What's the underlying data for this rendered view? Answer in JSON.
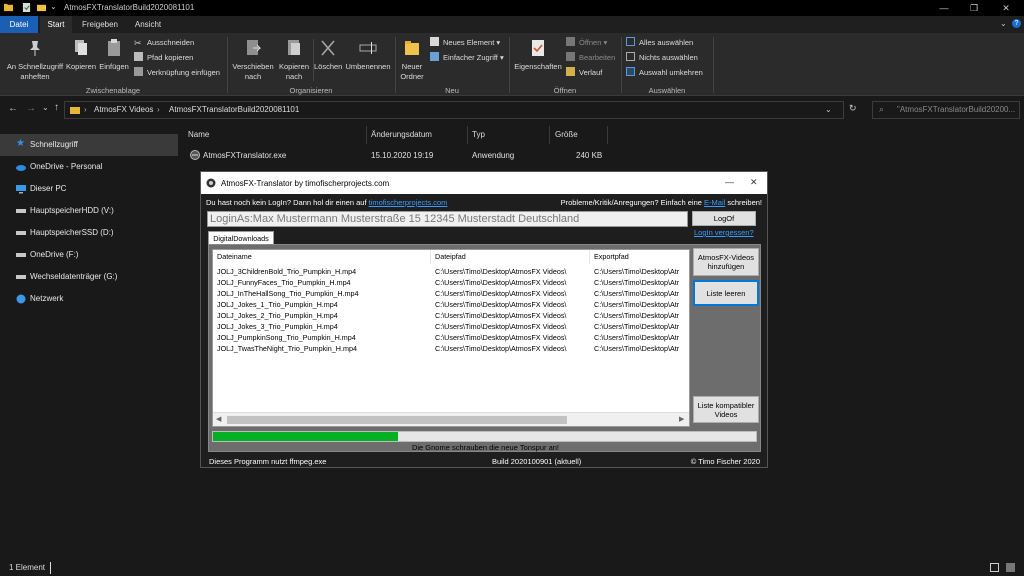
{
  "window": {
    "title": "AtmosFXTranslatorBuild2020081101",
    "controls": [
      "minimize-icon",
      "maximize-icon",
      "close-icon"
    ]
  },
  "ribbon_tabs": [
    "Datei",
    "Start",
    "Freigeben",
    "Ansicht"
  ],
  "ribbon": {
    "clipboard": {
      "pin_label_1": "An Schnellzugriff",
      "pin_label_2": "anheften",
      "copy_label": "Kopieren",
      "paste_label": "Einfügen",
      "cut_label": "Ausschneiden",
      "copy_path_label": "Pfad kopieren",
      "paste_shortcut_label": "Verknüpfung einfügen",
      "group_label": "Zwischenablage"
    },
    "organize": {
      "move_label_1": "Verschieben",
      "move_label_2": "nach",
      "copyto_label_1": "Kopieren",
      "copyto_label_2": "nach",
      "delete_label": "Löschen",
      "rename_label": "Umbenennen",
      "group_label": "Organisieren"
    },
    "new": {
      "newfolder_label_1": "Neuer",
      "newfolder_label_2": "Ordner",
      "newitem_label": "Neues Element",
      "easyaccess_label": "Einfacher Zugriff",
      "group_label": "Neu"
    },
    "open": {
      "properties_label": "Eigenschaften",
      "open_label": "Öffnen",
      "edit_label": "Bearbeiten",
      "history_label": "Verlauf",
      "group_label": "Öffnen"
    },
    "select": {
      "select_all_label": "Alles auswählen",
      "select_none_label": "Nichts auswählen",
      "invert_label": "Auswahl umkehren",
      "group_label": "Auswählen"
    }
  },
  "address": {
    "breadcrumb": [
      "AtmosFX Videos",
      "AtmosFXTranslatorBuild2020081101"
    ],
    "search_placeholder": "\"AtmosFXTranslatorBuild20200..."
  },
  "sidebar": {
    "items": [
      {
        "label": "Schnellzugriff",
        "icon": "star-icon"
      },
      {
        "label": "OneDrive - Personal",
        "icon": "cloud-icon"
      },
      {
        "label": "Dieser PC",
        "icon": "computer-icon"
      },
      {
        "label": "HauptspeicherHDD (V:)",
        "icon": "drive-icon"
      },
      {
        "label": "HauptspeicherSSD (D:)",
        "icon": "drive-icon"
      },
      {
        "label": "OneDrive (F:)",
        "icon": "drive-icon"
      },
      {
        "label": "Wechseldatenträger (G:)",
        "icon": "drive-icon"
      },
      {
        "label": "Netzwerk",
        "icon": "network-icon"
      }
    ]
  },
  "files": {
    "headers": {
      "name": "Name",
      "date": "Änderungsdatum",
      "type": "Typ",
      "size": "Größe"
    },
    "rows": [
      {
        "name": "AtmosFXTranslator.exe",
        "date": "15.10.2020 19:19",
        "type": "Anwendung",
        "size": "240 KB"
      }
    ]
  },
  "status": {
    "count": "1 Element"
  },
  "dialog": {
    "title": "AtmosFX-Translator by timofischerprojects.com",
    "no_login_text": "Du hast noch kein LogIn? Dann hol dir einen auf",
    "no_login_link": "timofischerprojects.com",
    "problems_text": "Probleme/Kritik/Anregungen? Einfach eine",
    "email_link": "E-Mail",
    "problems_suffix": "schreiben!",
    "login_value": "LoginAs:Max Mustermann Musterstraße 15 12345 Musterstadt Deutschland",
    "logoff_label": "LogOf",
    "forgot_link": "LogIn vergessen?",
    "tab_label": "DigitalDownloads",
    "columns": [
      "Dateiname",
      "Dateipfad",
      "Exportpfad"
    ],
    "rows": [
      {
        "name": "JOLJ_3ChildrenBold_Trio_Pumpkin_H.mp4",
        "path": "C:\\Users\\Timo\\Desktop\\AtmosFX Videos\\",
        "export": "C:\\Users\\Timo\\Desktop\\Atr"
      },
      {
        "name": "JOLJ_FunnyFaces_Trio_Pumpkin_H.mp4",
        "path": "C:\\Users\\Timo\\Desktop\\AtmosFX Videos\\",
        "export": "C:\\Users\\Timo\\Desktop\\Atr"
      },
      {
        "name": "JOLJ_InTheHallSong_Trio_Pumpkin_H.mp4",
        "path": "C:\\Users\\Timo\\Desktop\\AtmosFX Videos\\",
        "export": "C:\\Users\\Timo\\Desktop\\Atr"
      },
      {
        "name": "JOLJ_Jokes_1_Trio_Pumpkin_H.mp4",
        "path": "C:\\Users\\Timo\\Desktop\\AtmosFX Videos\\",
        "export": "C:\\Users\\Timo\\Desktop\\Atr"
      },
      {
        "name": "JOLJ_Jokes_2_Trio_Pumpkin_H.mp4",
        "path": "C:\\Users\\Timo\\Desktop\\AtmosFX Videos\\",
        "export": "C:\\Users\\Timo\\Desktop\\Atr"
      },
      {
        "name": "JOLJ_Jokes_3_Trio_Pumpkin_H.mp4",
        "path": "C:\\Users\\Timo\\Desktop\\AtmosFX Videos\\",
        "export": "C:\\Users\\Timo\\Desktop\\Atr"
      },
      {
        "name": "JOLJ_PumpkinSong_Trio_Pumpkin_H.mp4",
        "path": "C:\\Users\\Timo\\Desktop\\AtmosFX Videos\\",
        "export": "C:\\Users\\Timo\\Desktop\\Atr"
      },
      {
        "name": "JOLJ_TwasTheNight_Trio_Pumpkin_H.mp4",
        "path": "C:\\Users\\Timo\\Desktop\\AtmosFX Videos\\",
        "export": "C:\\Users\\Timo\\Desktop\\Atr"
      }
    ],
    "add_videos_label_1": "AtmosFX-Videos",
    "add_videos_label_2": "hinzufügen",
    "clear_list_label": "Liste leeren",
    "compat_list_label_1": "Liste kompatibler",
    "compat_list_label_2": "Videos",
    "progress_fraction": 0.34,
    "progress_text": "Die Gnome schrauben die neue Tonspur an!",
    "footer_ffmpeg": "Dieses Programm nutzt ffmpeg.exe",
    "footer_build": "Build 2020100901 (aktuell)",
    "footer_copyright": "© Timo Fischer 2020"
  }
}
